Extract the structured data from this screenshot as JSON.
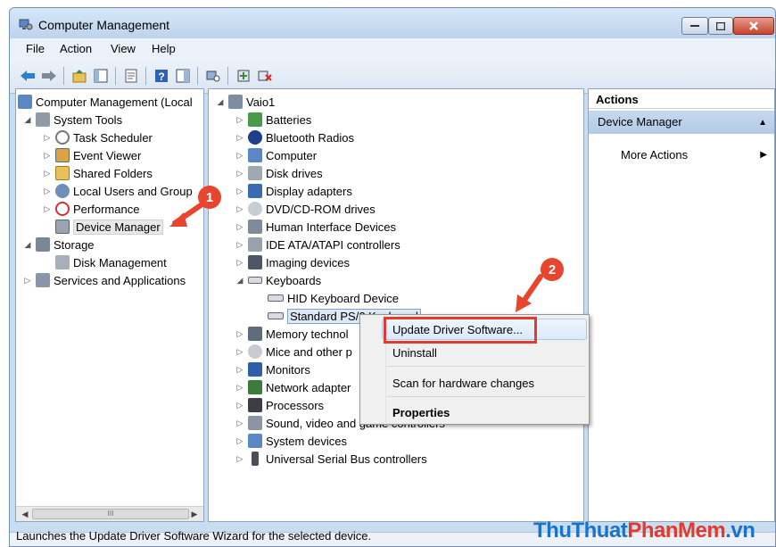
{
  "window": {
    "title": "Computer Management"
  },
  "menubar": [
    "File",
    "Action",
    "View",
    "Help"
  ],
  "toolbar": {
    "icons": [
      "back-arrow-icon",
      "forward-arrow-icon",
      "up-folder-icon",
      "show-hide-tree-icon",
      "properties-icon",
      "help-icon",
      "show-action-pane-icon",
      "refresh-icon",
      "scan-hardware-icon",
      "remove-device-icon"
    ]
  },
  "left_tree": {
    "root": "Computer Management (Local",
    "system_tools": "System Tools",
    "items": [
      "Task Scheduler",
      "Event Viewer",
      "Shared Folders",
      "Local Users and Group",
      "Performance",
      "Device Manager"
    ],
    "storage": "Storage",
    "disk_management": "Disk Management",
    "services": "Services and Applications",
    "scroll_label": "III"
  },
  "device_tree": {
    "root": "Vaio1",
    "categories": [
      "Batteries",
      "Bluetooth Radios",
      "Computer",
      "Disk drives",
      "Display adapters",
      "DVD/CD-ROM drives",
      "Human Interface Devices",
      "IDE ATA/ATAPI controllers",
      "Imaging devices",
      "Keyboards"
    ],
    "keyboards": [
      "HID Keyboard Device",
      "Standard PS/2 Keyboard"
    ],
    "after": [
      "Memory technol",
      "Mice and other p",
      "Monitors",
      "Network adapter",
      "Processors",
      "Sound, video and game controllers",
      "System devices",
      "Universal Serial Bus controllers"
    ]
  },
  "actions": {
    "header": "Actions",
    "section": "Device Manager",
    "more": "More Actions"
  },
  "context_menu": {
    "update": "Update Driver Software...",
    "uninstall": "Uninstall",
    "scan": "Scan for hardware changes",
    "properties": "Properties"
  },
  "badges": [
    "1",
    "2"
  ],
  "status": "Launches the Update Driver Software Wizard for the selected device.",
  "watermark": {
    "part1": "ThuThuat",
    "part2": "PhanMem",
    "part3": ".vn"
  },
  "colors": {
    "accent": "#e8452f",
    "selection": "#c6d9ef",
    "watermark_blue": "#1a73c8",
    "watermark_red": "#e23a2d"
  }
}
